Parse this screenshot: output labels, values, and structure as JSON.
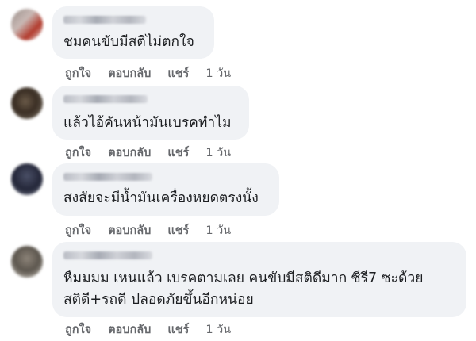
{
  "comments": [
    {
      "text_lines": [
        "ชมคนขับมีสติไม่ตกใจ"
      ],
      "actions": {
        "like": "ถูกใจ",
        "reply": "ตอบกลับ",
        "share": "แชร์",
        "time": "1 วัน"
      }
    },
    {
      "text_lines": [
        "แล้วไอ้คันหน้ามันเบรคทำไม"
      ],
      "actions": {
        "like": "ถูกใจ",
        "reply": "ตอบกลับ",
        "share": "แชร์",
        "time": "1 วัน"
      }
    },
    {
      "text_lines": [
        "สงสัยจะมีน้ำมันเครื่องหยดตรงนั้ง"
      ],
      "actions": {
        "like": "ถูกใจ",
        "reply": "ตอบกลับ",
        "share": "แชร์",
        "time": "1 วัน"
      }
    },
    {
      "text_lines": [
        "หืมมมม เหนแล้ว เบรคตามเลย คนขับมีสติดีมาก ซีรี7 ซะด้วย",
        "สติดี+รถดี ปลอดภัยขึ้นอีกหน่อย"
      ],
      "actions": {
        "like": "ถูกใจ",
        "reply": "ตอบกลับ",
        "share": "แชร์",
        "time": "1 วัน"
      }
    }
  ],
  "colors": {
    "bubble": "#f0f2f5",
    "text": "#1c1e21",
    "action_text": "#65676b"
  }
}
